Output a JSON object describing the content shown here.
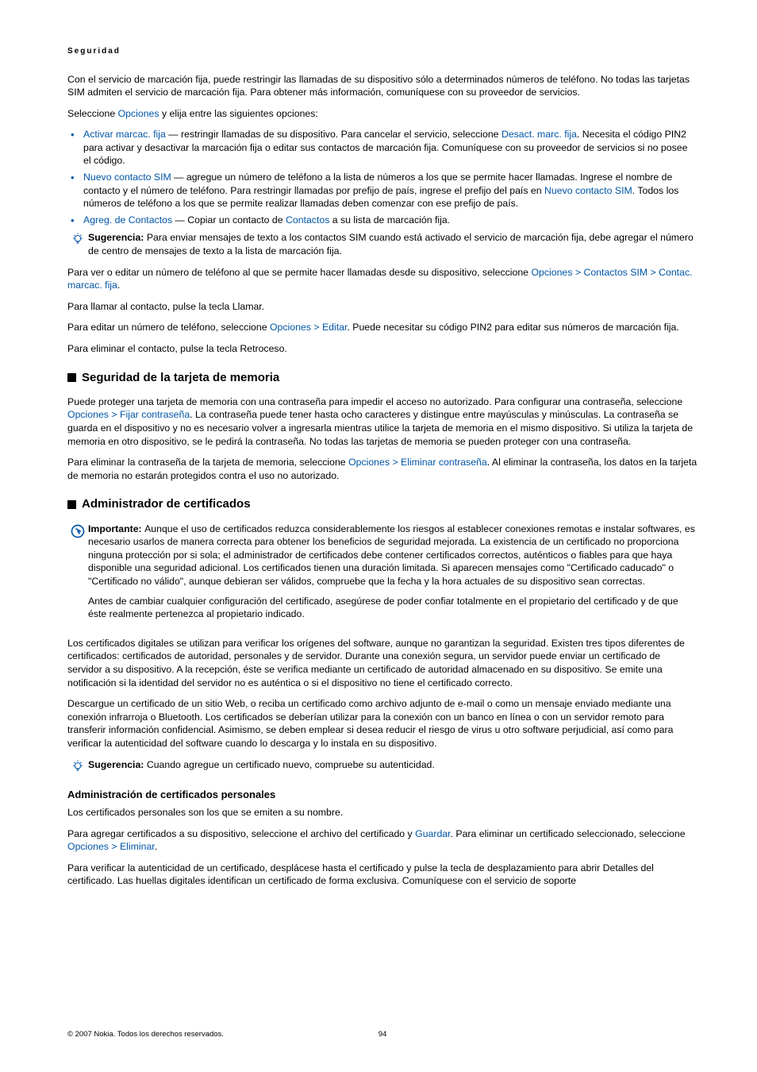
{
  "header": "Seguridad",
  "p1a": "Con el servicio de marcación fija, puede restringir las llamadas de su dispositivo sólo a determinados números de teléfono. No todas las tarjetas SIM admiten el servicio de marcación fija. Para obtener más información, comuníquese con su proveedor de servicios.",
  "p1b_a": "Seleccione ",
  "p1b_b": "Opciones",
  "p1b_c": " y elija entre las siguientes opciones:",
  "bul1_a": "Activar marcac. fija",
  "bul1_b": " — restringir llamadas de su dispositivo. Para cancelar el servicio, seleccione ",
  "bul1_c": "Desact. marc. fija",
  "bul1_d": ". Necesita el código PIN2 para activar y desactivar la marcación fija o editar sus contactos de marcación fija. Comuníquese con su proveedor de servicios si no posee el código.",
  "bul2_a": "Nuevo contacto SIM",
  "bul2_b": " — agregue un número de teléfono a la lista de números a los que se permite hacer llamadas. Ingrese el nombre de contacto y el número de teléfono. Para restringir llamadas por prefijo de país, ingrese el prefijo del país en ",
  "bul2_c": "Nuevo contacto SIM",
  "bul2_d": ". Todos los números de teléfono a los que se permite realizar llamadas deben comenzar con ese prefijo de país.",
  "bul3_a": "Agreg. de Contactos",
  "bul3_b": " — Copiar un contacto de ",
  "bul3_c": "Contactos",
  "bul3_d": " a su lista de marcación fija.",
  "tip1_label": "Sugerencia: ",
  "tip1_text": "Para enviar mensajes de texto a los contactos SIM cuando está activado el servicio de marcación fija, debe agregar el número de centro de mensajes de texto a la lista de marcación fija.",
  "p2_a": "Para ver o editar un número de teléfono al que se permite hacer llamadas desde su dispositivo, seleccione ",
  "p2_b": "Opciones",
  "p2_c": "Contactos SIM",
  "p2_d": "Contac. marcac. fija",
  "p3": "Para llamar al contacto, pulse la tecla Llamar.",
  "p4_a": "Para editar un número de teléfono, seleccione ",
  "p4_b": "Opciones",
  "p4_c": "Editar",
  "p4_d": ". Puede necesitar su código PIN2 para editar sus números de marcación fija.",
  "p5": "Para eliminar el contacto, pulse la tecla Retroceso.",
  "h2a": "Seguridad de la tarjeta de memoria",
  "p6_a": "Puede proteger una tarjeta de memoria con una contraseña para impedir el acceso no autorizado. Para configurar una contraseña, seleccione ",
  "p6_b": "Opciones",
  "p6_c": "Fijar contraseña",
  "p6_d": ". La contraseña puede tener hasta ocho caracteres y distingue entre mayúsculas y minúsculas. La contraseña se guarda en el dispositivo y no es necesario volver a ingresarla mientras utilice la tarjeta de memoria en el mismo dispositivo. Si utiliza la tarjeta de memoria en otro dispositivo, se le pedirá la contraseña. No todas las tarjetas de memoria se pueden proteger con una contraseña.",
  "p7_a": "Para eliminar la contraseña de la tarjeta de memoria, seleccione ",
  "p7_b": "Opciones",
  "p7_c": "Eliminar contraseña",
  "p7_d": ". Al eliminar la contraseña, los datos en la tarjeta de memoria no estarán protegidos contra el uso no autorizado.",
  "h2b": "Administrador de certificados",
  "imp_label": "Importante:  ",
  "imp_text": "Aunque el uso de certificados reduzca considerablemente los riesgos al establecer conexiones remotas e instalar softwares, es necesario usarlos de manera correcta para obtener los beneficios de seguridad mejorada. La existencia de un certificado no proporciona ninguna protección por si sola; el administrador de certificados debe contener certificados correctos, auténticos o fiables para que haya disponible una seguridad adicional. Los certificados tienen una duración limitada. Si aparecen mensajes como \"Certificado caducado\" o \"Certificado no válido\", aunque debieran ser válidos, compruebe que la fecha y la hora actuales de su dispositivo sean correctas.",
  "imp_text2": "Antes de cambiar cualquier configuración del certificado, asegúrese de poder confiar totalmente en el propietario del certificado y de que éste realmente pertenezca al propietario indicado.",
  "p8": "Los certificados digitales se utilizan para verificar los orígenes del software, aunque no garantizan la seguridad. Existen tres tipos diferentes de certificados: certificados de autoridad, personales y de servidor. Durante una conexión segura, un servidor puede enviar un certificado de servidor a su dispositivo. A la recepción, éste se verifica mediante un certificado de autoridad almacenado en su dispositivo. Se emite una notificación si la identidad del servidor no es auténtica o si el dispositivo no tiene el certificado correcto.",
  "p9": "Descargue un certificado de un sitio Web, o reciba un certificado como archivo adjunto de e-mail o como un mensaje enviado mediante una conexión infrarroja o Bluetooth. Los certificados se deberían utilizar para la conexión con un banco en línea o con un servidor remoto para transferir información confidencial. Asimismo, se deben emplear si desea reducir el riesgo de virus u otro software perjudicial, así como para verificar la autenticidad del software cuando lo descarga y lo instala en su dispositivo.",
  "tip2_label": "Sugerencia: ",
  "tip2_text": "Cuando agregue un certificado nuevo, compruebe su autenticidad.",
  "h3a": "Administración de certificados personales",
  "p10": "Los certificados personales son los que se emiten a su nombre.",
  "p11_a": "Para agregar certificados a su dispositivo, seleccione el archivo del certificado y ",
  "p11_b": "Guardar",
  "p11_c": ". Para eliminar un certificado seleccionado, seleccione ",
  "p11_d": "Opciones",
  "p11_e": "Eliminar",
  "p12": "Para verificar la autenticidad de un certificado, desplácese hasta el certificado y pulse la tecla de desplazamiento para abrir Detalles del certificado. Las huellas digitales identifican un certificado de forma exclusiva. Comuníquese con el servicio de soporte",
  "footer_left": "© 2007 Nokia. Todos los derechos reservados.",
  "footer_page": "94"
}
